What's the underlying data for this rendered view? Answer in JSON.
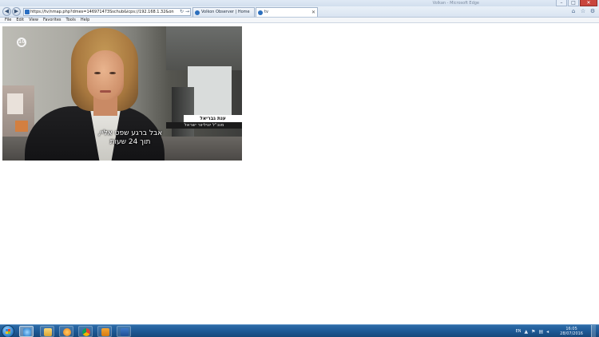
{
  "browser": {
    "window_title": "Volkan - Microsoft Edge",
    "address": "https://tv/nmap.php?dmes=146971473Sschub&icps://192.168.1.32&onlejo/786&port=4504",
    "tabs": [
      {
        "label": "Volkon Observer | Home"
      },
      {
        "label": "tv"
      }
    ],
    "window_controls": {
      "minimize": "–",
      "maximize": "□",
      "close": "✕"
    },
    "nav": {
      "back": "◀",
      "forward": "▶",
      "refresh": "↻",
      "go": "→"
    },
    "icons": {
      "home": "⌂",
      "favorites": "☆",
      "tools": "⚙"
    }
  },
  "menu": {
    "items": [
      "File",
      "Edit",
      "View",
      "Favorites",
      "Tools",
      "Help"
    ]
  },
  "video": {
    "channel_logo": "10",
    "lower_third_name": "ענת גבריאל",
    "lower_third_title": "מנכ\"ל יוניליוור ישראל",
    "subtitle_line1": "אבל ברגע שפט אליי,",
    "subtitle_line2": "תוך 24 שעות"
  },
  "taskbar": {
    "apps": [
      "Internet Explorer",
      "File Explorer",
      "Media Player",
      "Chrome",
      "Outlook",
      "Word"
    ],
    "language": "EN",
    "clock_time": "16:05",
    "clock_date": "28/07/2016"
  }
}
